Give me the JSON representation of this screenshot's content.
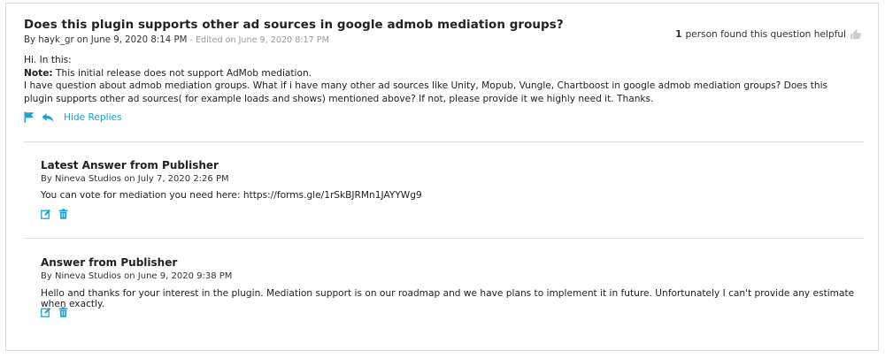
{
  "question": {
    "title": "Does this plugin supports other ad sources in google admob mediation groups?",
    "meta_by": "By hayk_gr on June 9, 2020 8:14 PM",
    "meta_edited": " - Edited on June 9, 2020 8:17 PM",
    "helpful_count": "1",
    "helpful_text": "person found this question helpful",
    "body_line1": "Hi. In this:",
    "note_label": "Note:",
    "note_text": " This initial release does not support AdMob mediation.",
    "body_line3": "I have question about admob mediation groups. What if i have many other ad sources like Unity, Mopub, Vungle, Chartboost in google admob mediation groups? Does this plugin supports other ad sources( for example loads and shows) mentioned above? If not, please provide it we highly need it. Thanks.",
    "hide_replies_label": "Hide Replies"
  },
  "answers": [
    {
      "title": "Latest Answer from Publisher",
      "meta": "By Nineva Studios on July 7, 2020 2:26 PM",
      "body": "You can vote for mediation you need here: https://forms.gle/1rSkBJRMn1JAYYWg9"
    },
    {
      "title": "Answer from Publisher",
      "meta": "By Nineva Studios on June 9, 2020 9:38 PM",
      "body": "Hello and thanks for your interest in the plugin. Mediation support is on our roadmap and we have plans to implement it in future. Unfortunately I can't provide any estimate when exactly."
    }
  ],
  "icons": {
    "flag": "flag-icon",
    "reply": "reply-icon",
    "thumb": "thumbs-up-icon",
    "edit": "edit-icon",
    "trash": "trash-icon"
  },
  "colors": {
    "accent": "#1da1d6",
    "muted": "#999999",
    "border": "#d9d9d9",
    "thumb": "#cccccc"
  }
}
